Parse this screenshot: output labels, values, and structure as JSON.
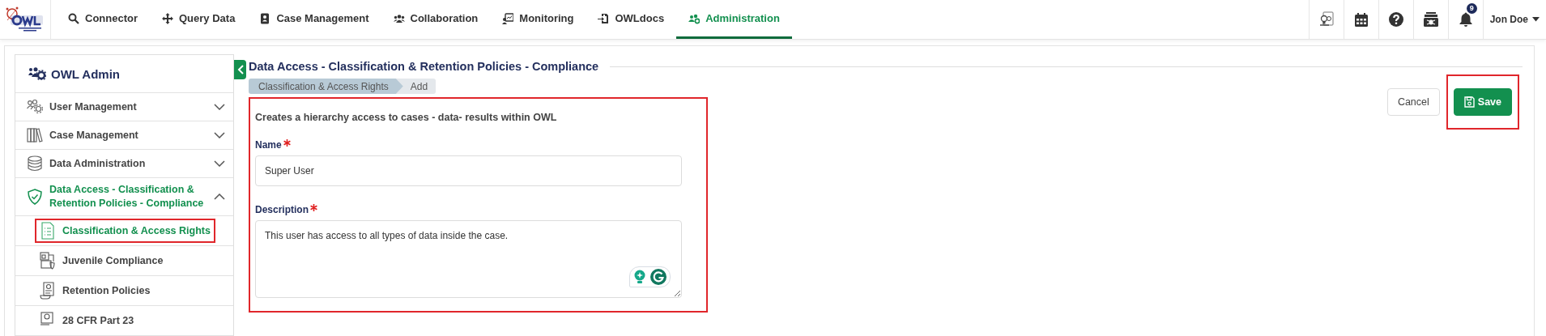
{
  "nav": {
    "items": [
      {
        "label": "Connector",
        "selected": false
      },
      {
        "label": "Query Data",
        "selected": false
      },
      {
        "label": "Case Management",
        "selected": false
      },
      {
        "label": "Collaboration",
        "selected": false
      },
      {
        "label": "Monitoring",
        "selected": false
      },
      {
        "label": "OWLdocs",
        "selected": false
      },
      {
        "label": "Administration",
        "selected": true
      }
    ]
  },
  "notifications": {
    "count": "9"
  },
  "user": {
    "name": "Jon Doe"
  },
  "sidebar": {
    "title": "OWL Admin",
    "items": [
      {
        "label": "User Management",
        "expanded": false,
        "selected": false
      },
      {
        "label": "Case Management",
        "expanded": false,
        "selected": false
      },
      {
        "label": "Data Administration",
        "expanded": false,
        "selected": false
      },
      {
        "label": "Data Access - Classification & Retention Policies - Compliance",
        "expanded": true,
        "selected": true,
        "children": [
          {
            "label": "Classification & Access Rights",
            "selected": true,
            "highlighted": true
          },
          {
            "label": "Juvenile Compliance",
            "selected": false,
            "highlighted": false
          },
          {
            "label": "Retention Policies",
            "selected": false,
            "highlighted": false
          },
          {
            "label": "28 CFR Part 23",
            "selected": false,
            "highlighted": false
          }
        ]
      }
    ]
  },
  "page": {
    "title": "Data Access - Classification & Retention Policies - Compliance",
    "breadcrumb": [
      "Classification & Access Rights",
      "Add"
    ],
    "form": {
      "highlighted": true,
      "intro": "Creates a hierarchy access to cases - data- results within OWL",
      "fields": [
        {
          "kind": "input",
          "label": "Name",
          "required": true,
          "value": "Super User"
        },
        {
          "kind": "textarea",
          "label": "Description",
          "required": true,
          "value": "This user has access to all types of data inside the case."
        }
      ]
    },
    "buttons": [
      {
        "kind": "secondary",
        "label": "Cancel",
        "highlighted": false
      },
      {
        "kind": "primary",
        "label": "Save",
        "highlighted": true
      }
    ]
  }
}
